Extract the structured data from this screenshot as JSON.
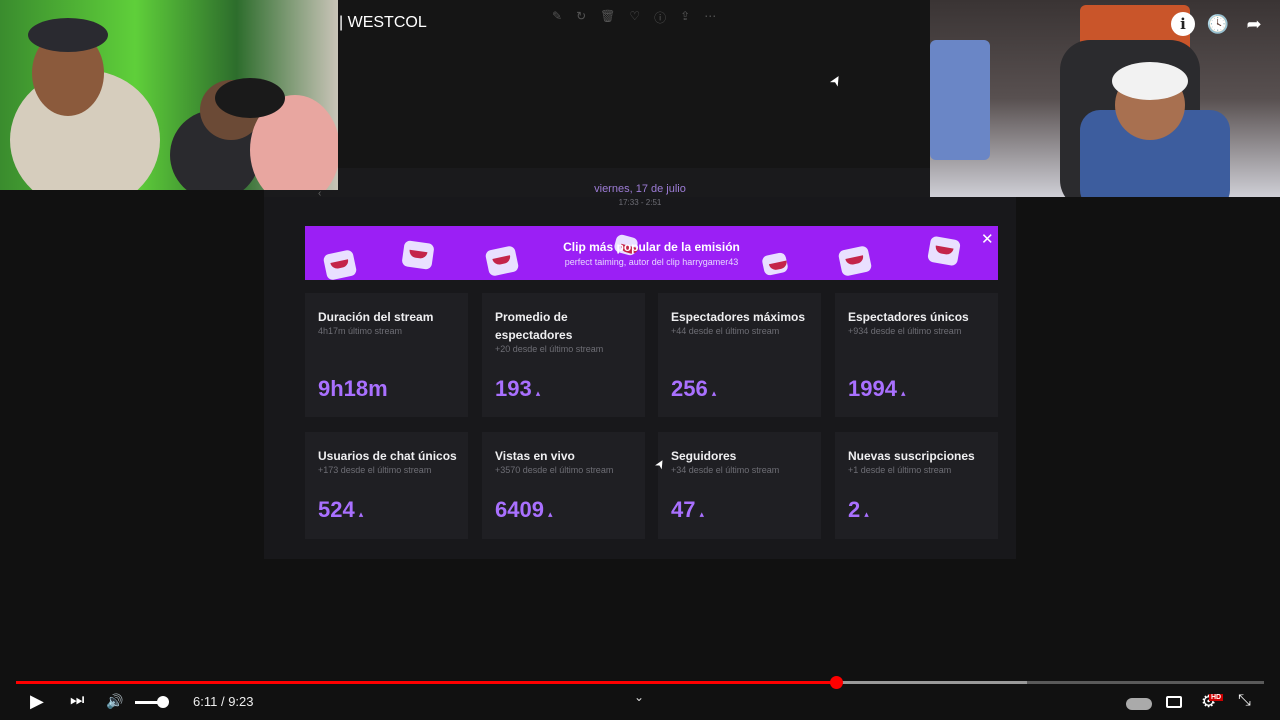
{
  "video": {
    "title": "| WESTCOL",
    "time_current": "6:11",
    "time_total": "9:23",
    "time_separator": " / ",
    "progress_played_fraction": 0.657,
    "progress_buffered_fraction": 0.81,
    "volume_fraction": 0.8
  },
  "overlay": {
    "date": "viernes, 17 de julio",
    "time_range": "17:33 - 2:51"
  },
  "banner": {
    "title": "Clip más popular de la emisión",
    "subtitle": "perfect taiming, autor del clip harrygamer43",
    "close_glyph": "✕",
    "background": "#9b1ff5"
  },
  "stats": [
    {
      "title": "Duración del stream",
      "subtitle": "4h17m último stream",
      "value": "9h18m",
      "trend": ""
    },
    {
      "title": "Promedio de espectadores",
      "subtitle": "+20 desde el último stream",
      "value": "193",
      "trend": "▴"
    },
    {
      "title": "Espectadores máximos",
      "subtitle": "+44 desde el último stream",
      "value": "256",
      "trend": "▴"
    },
    {
      "title": "Espectadores únicos",
      "subtitle": "+934 desde el último stream",
      "value": "1994",
      "trend": "▴"
    },
    {
      "title": "Usuarios de chat únicos",
      "subtitle": "+173 desde el último stream",
      "value": "524",
      "trend": "▴"
    },
    {
      "title": "Vistas en vivo",
      "subtitle": "+3570 desde el último stream",
      "value": "6409",
      "trend": "▴"
    },
    {
      "title": "Seguidores",
      "subtitle": "+34 desde el último stream",
      "value": "47",
      "trend": "▴"
    },
    {
      "title": "Nuevas suscripciones",
      "subtitle": "+1 desde el último stream",
      "value": "2",
      "trend": "▴"
    }
  ],
  "icons": {
    "play": "▶",
    "next": "⏭",
    "volume": "🔊",
    "info": "i",
    "clock": "🕓",
    "share": "➦",
    "chevron": "⌄",
    "cursor": "➤",
    "hd": "HD"
  },
  "colors": {
    "accent_purple": "#a970ff",
    "progress_red": "#ff0000",
    "panel": "#18181b",
    "card": "#1f1f23"
  }
}
